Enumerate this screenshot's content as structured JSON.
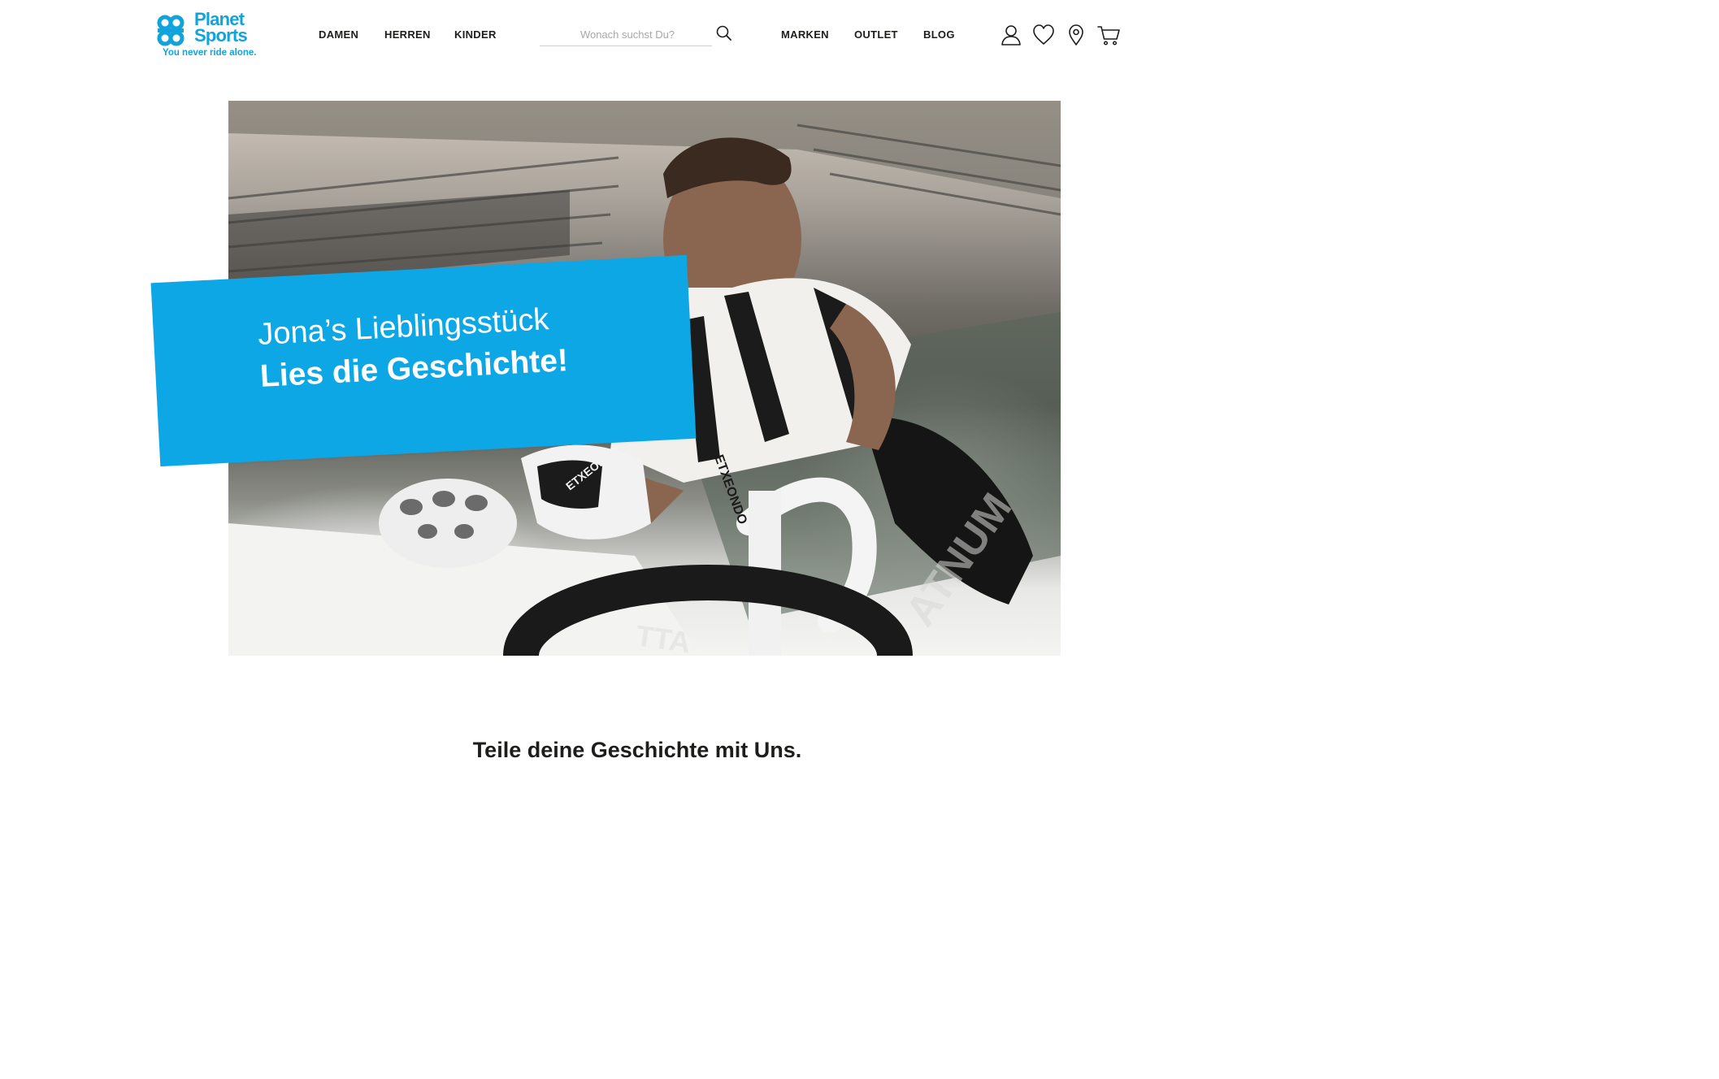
{
  "brand": {
    "name_line1": "Planet",
    "name_line2": "Sports",
    "tagline": "You never ride alone.",
    "color": "#11a3dc"
  },
  "nav_left": [
    {
      "label": "DAMEN"
    },
    {
      "label": "HERREN"
    },
    {
      "label": "KINDER"
    }
  ],
  "search": {
    "placeholder": "Wonach suchst Du?",
    "icon": "search-icon"
  },
  "nav_right": [
    {
      "label": "MARKEN"
    },
    {
      "label": "OUTLET"
    },
    {
      "label": "BLOG"
    }
  ],
  "header_icons": [
    "user-icon",
    "heart-icon",
    "location-pin-icon",
    "cart-icon"
  ],
  "hero": {
    "banner_line1": "Jona’s Lieblingsstück",
    "banner_line2": "Lies die Geschichte!",
    "banner_color": "#0da7e6",
    "image_text_1": "ETXEONDO",
    "image_text_2": "ATNUM",
    "image_text_3": "TTA"
  },
  "section": {
    "title": "Teile deine Geschichte mit Uns."
  }
}
